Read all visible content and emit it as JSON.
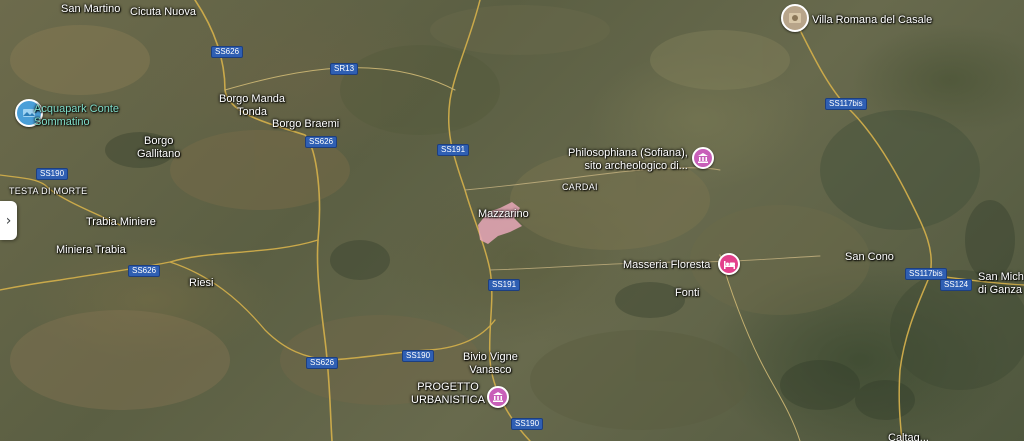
{
  "map": {
    "view": "satellite",
    "places": [
      {
        "key": "san_martino",
        "text": "San Martino"
      },
      {
        "key": "cicuta_nuova",
        "text": "Cicuta Nuova"
      },
      {
        "key": "borgo_manda_tonda",
        "text": "Borgo Manda\nTonda"
      },
      {
        "key": "borgo_braemi",
        "text": "Borgo Braemi"
      },
      {
        "key": "borgo_gallitano",
        "text": "Borgo\nGallitano"
      },
      {
        "key": "testa_di_morte",
        "text": "TESTA DI MORTE"
      },
      {
        "key": "trabia_miniere",
        "text": "Trabia Miniere"
      },
      {
        "key": "miniera_trabia",
        "text": "Miniera Trabia"
      },
      {
        "key": "riesi",
        "text": "Riesi"
      },
      {
        "key": "mazzarino",
        "text": "Mazzarino"
      },
      {
        "key": "cardai",
        "text": "CARDAI"
      },
      {
        "key": "fonti",
        "text": "Fonti"
      },
      {
        "key": "san_cono",
        "text": "San Cono"
      },
      {
        "key": "san_michele",
        "text": "San Mich\ndi Ganza"
      },
      {
        "key": "bivio_vigne",
        "text": "Bivio Vigne\nVanasco"
      },
      {
        "key": "caltagirone_partial",
        "text": "Caltag..."
      }
    ],
    "pois": [
      {
        "key": "acquapark",
        "text": "Acquapark Conte\nSommatino",
        "icon": "photo-thumbnail-icon",
        "color": "#4a9fd8"
      },
      {
        "key": "villa_romana",
        "text": "Villa Romana del Casale",
        "icon": "photo-thumbnail-icon",
        "color": "#b8a58a"
      },
      {
        "key": "philosophiana",
        "text": "Philosophiana (Sofiana),\nsito archeologico di...",
        "icon": "museum-icon",
        "color": "#c85fb9"
      },
      {
        "key": "masseria",
        "text": "Masseria Floresta",
        "icon": "bed-icon",
        "color": "#e3418c"
      },
      {
        "key": "progetto",
        "text": "PROGETTO\nURBANISTICA",
        "icon": "museum-icon",
        "color": "#c85fb9"
      }
    ],
    "roads": [
      {
        "key": "ss626_a",
        "text": "SS626"
      },
      {
        "key": "sr13",
        "text": "SR13"
      },
      {
        "key": "ss626_b",
        "text": "SS626"
      },
      {
        "key": "ss191_a",
        "text": "SS191"
      },
      {
        "key": "ss190_a",
        "text": "SS190"
      },
      {
        "key": "ss626_c",
        "text": "SS626"
      },
      {
        "key": "ss191_b",
        "text": "SS191"
      },
      {
        "key": "ss190_b",
        "text": "SS190"
      },
      {
        "key": "ss626_d",
        "text": "SS626"
      },
      {
        "key": "ss190_c",
        "text": "SS190"
      },
      {
        "key": "ss117bis_a",
        "text": "SS117bis"
      },
      {
        "key": "ss117bis_b",
        "text": "SS117bis"
      },
      {
        "key": "ss124",
        "text": "SS124"
      }
    ],
    "controls": {
      "side_panel_toggle": "›"
    }
  }
}
